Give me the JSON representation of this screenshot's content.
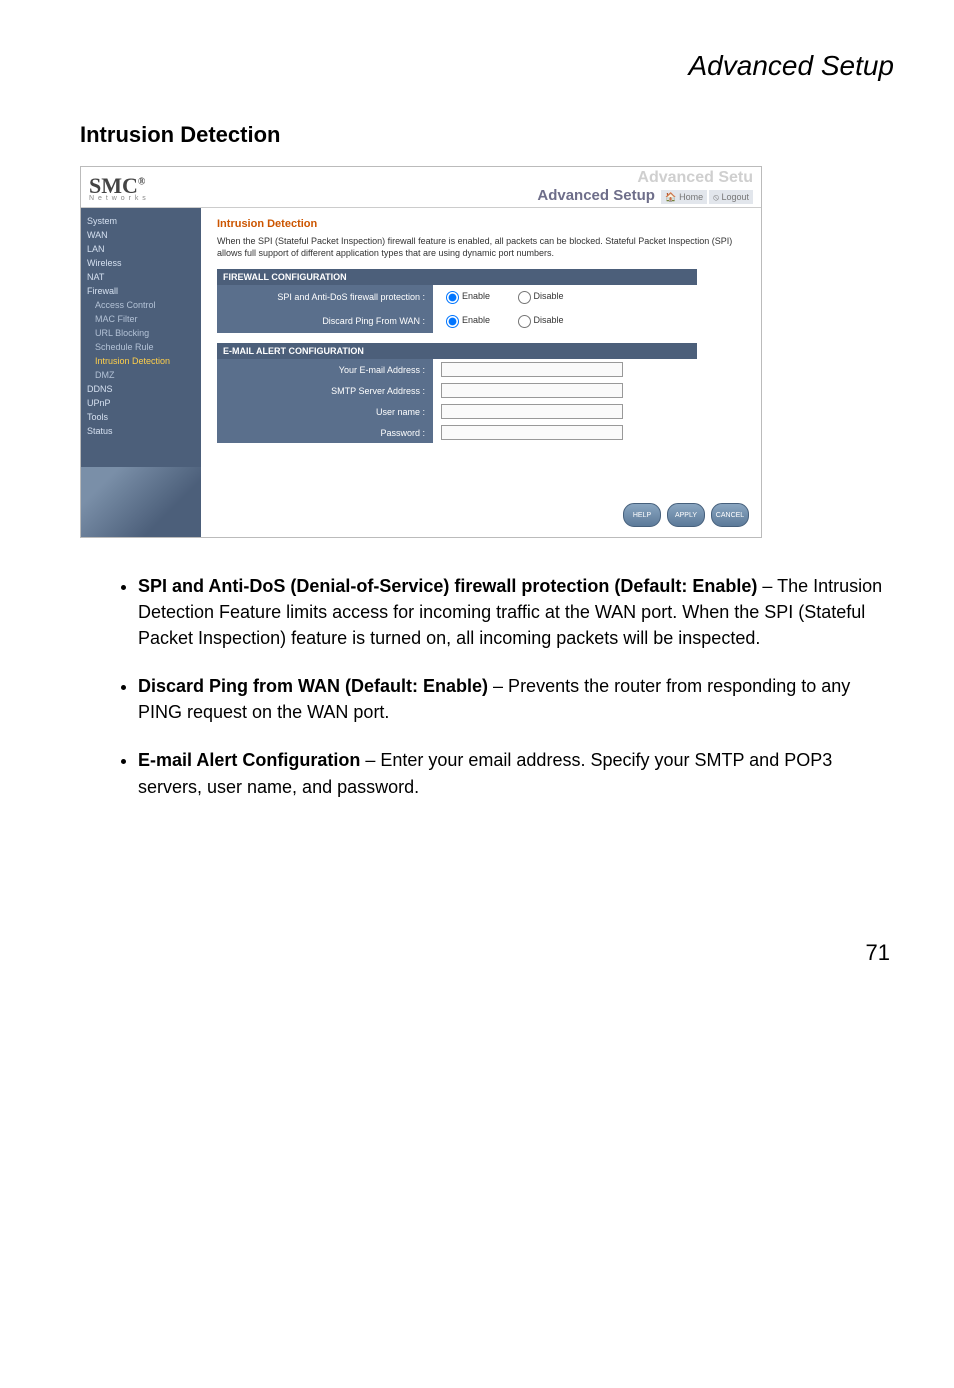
{
  "page": {
    "header": "Advanced Setup",
    "section_title": "Intrusion Detection",
    "page_number": "71"
  },
  "screenshot": {
    "logo_main": "SMC",
    "logo_reg": "®",
    "logo_sub": "N e t w o r k s",
    "adv_ghost": "Advanced Setu",
    "adv_setup": "Advanced Setup",
    "link_home": "Home",
    "link_logout": "Logout",
    "sidebar": {
      "items": [
        "System",
        "WAN",
        "LAN",
        "Wireless",
        "NAT",
        "Firewall"
      ],
      "subitems": [
        "Access Control",
        "MAC Filter",
        "URL Blocking",
        "Schedule Rule",
        "Intrusion Detection",
        "DMZ"
      ],
      "items2": [
        "DDNS",
        "UPnP",
        "Tools",
        "Status"
      ]
    },
    "content": {
      "title": "Intrusion Detection",
      "intro": "When the SPI (Stateful Packet Inspection) firewall feature is enabled, all packets can be blocked. Stateful Packet Inspection (SPI) allows full support of different application types that are using dynamic port numbers.",
      "firewall_header": "FIREWALL CONFIGURATION",
      "row1_label": "SPI and Anti-DoS firewall protection :",
      "row2_label": "Discard Ping From WAN :",
      "enable": "Enable",
      "disable": "Disable",
      "email_header": "E-MAIL ALERT CONFIGURATION",
      "email_row1": "Your E-mail Address :",
      "email_row2": "SMTP Server Address :",
      "email_row3": "User name :",
      "email_row4": "Password :",
      "btn_help": "HELP",
      "btn_apply": "APPLY",
      "btn_cancel": "CANCEL"
    }
  },
  "bullets": [
    {
      "bold": "SPI and Anti-DoS (Denial-of-Service) firewall protection (Default: Enable)",
      "text": " – The Intrusion Detection Feature limits access for incoming traffic at the WAN port. When the SPI (Stateful Packet Inspection) feature is turned on, all incoming packets will be inspected."
    },
    {
      "bold": "Discard Ping from WAN (Default: Enable)",
      "text": " – Prevents the router from responding to any PING request on the WAN port."
    },
    {
      "bold": "E-mail Alert Configuration",
      "text": " – Enter your email address. Specify your SMTP and POP3 servers, user name, and password."
    }
  ]
}
